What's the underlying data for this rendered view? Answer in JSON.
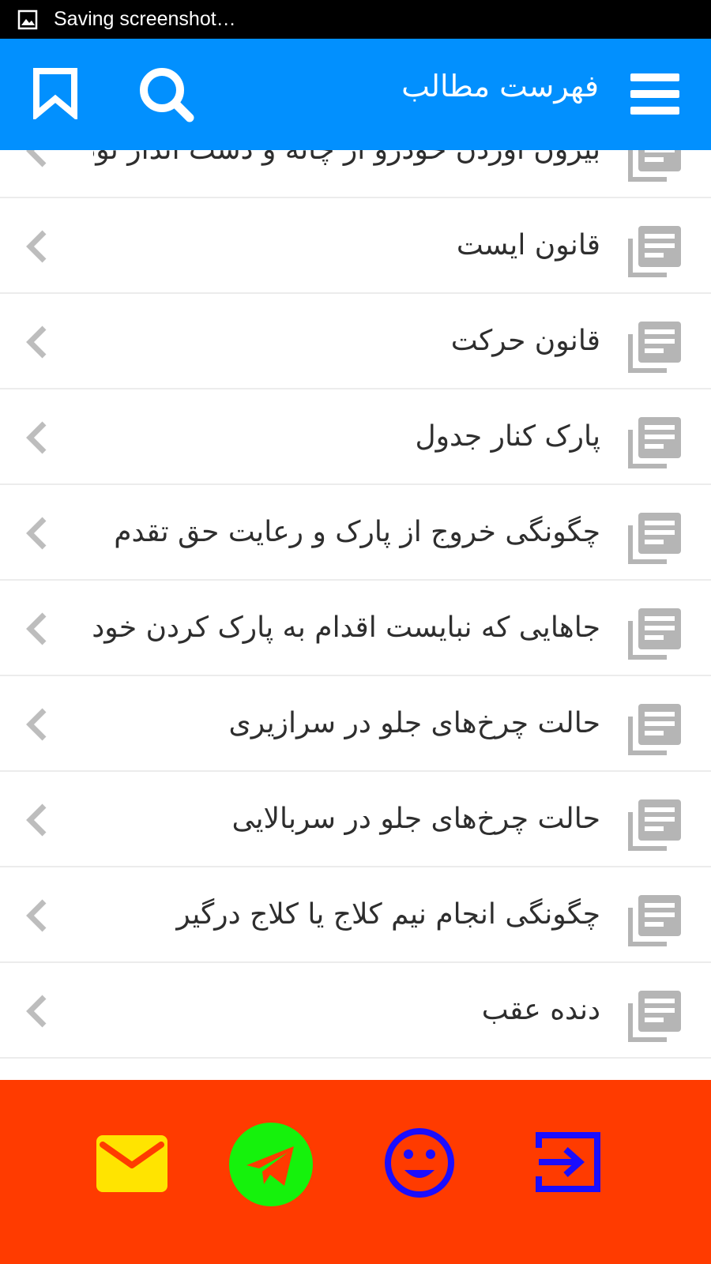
{
  "status_bar": {
    "icon": "image-icon",
    "text": "Saving screenshot…"
  },
  "app_bar": {
    "title": "فهرست مطالب",
    "menu_icon": "menu-icon",
    "search_icon": "search-icon",
    "bookmark_icon": "bookmark-icon",
    "color": "#0290fe"
  },
  "list": {
    "item_icon": "document-icon",
    "chevron_icon": "chevron-left-icon",
    "items": [
      {
        "label": "بیرون آوردن خودرو از چانه و دست انداز نود"
      },
      {
        "label": "قانون ایست"
      },
      {
        "label": "قانون حرکت"
      },
      {
        "label": "پارک  کنار جدول"
      },
      {
        "label": "چگونگی خروج از پارک و رعایت حق تقدم"
      },
      {
        "label": "جاهایی که نبایست اقدام به پارک کردن خودرو"
      },
      {
        "label": "حالت چرخ‌های جلو در سرازیری"
      },
      {
        "label": "حالت چرخ‌های جلو در سربالایی"
      },
      {
        "label": "چگونگی انجام نیم کلاج یا کلاج درگیر"
      },
      {
        "label": "دنده عقب"
      }
    ]
  },
  "bottom_bar": {
    "color": "#ff3b00",
    "buttons": [
      {
        "icon": "mail-icon",
        "color": "#ffe400"
      },
      {
        "icon": "telegram-icon",
        "color": "#15f20c"
      },
      {
        "icon": "smiley-icon",
        "color": "#1a0dff"
      },
      {
        "icon": "login-icon",
        "color": "#1a0dff"
      }
    ]
  }
}
